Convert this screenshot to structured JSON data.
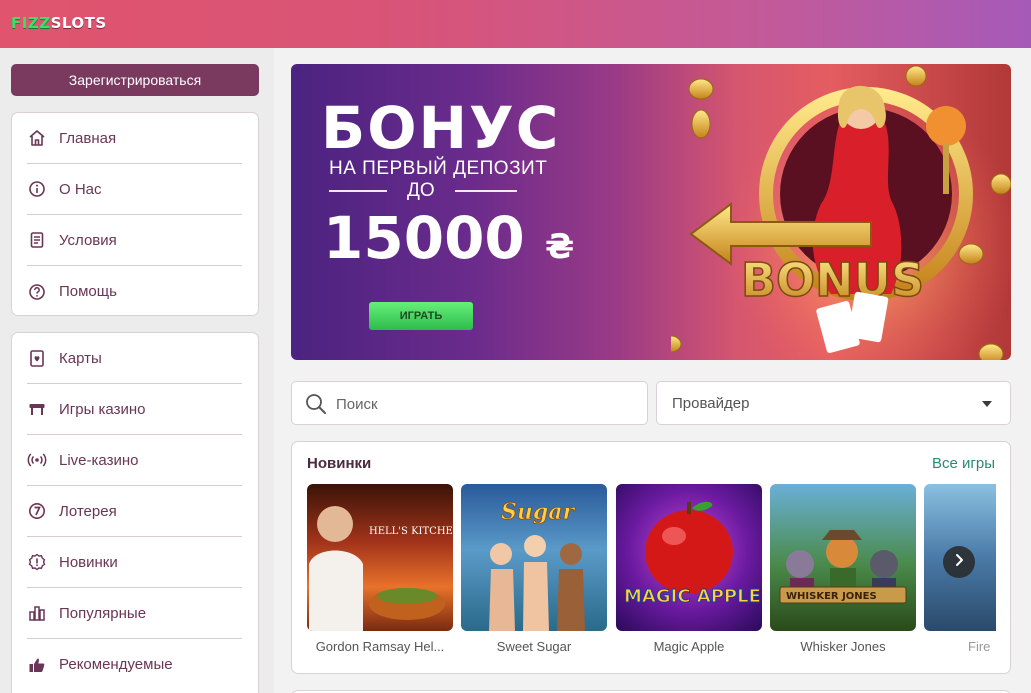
{
  "header": {
    "logo_part1": "FIZZ",
    "logo_part2": "SLOTS"
  },
  "sidebar": {
    "register_label": "Зарегистрироваться",
    "menu_top": [
      {
        "label": "Главная",
        "icon": "home-icon"
      },
      {
        "label": "О Нас",
        "icon": "info-icon"
      },
      {
        "label": "Условия",
        "icon": "document-icon"
      },
      {
        "label": "Помощь",
        "icon": "help-icon"
      }
    ],
    "menu_games": [
      {
        "label": "Карты",
        "icon": "cards-icon"
      },
      {
        "label": "Игры казино",
        "icon": "table-icon"
      },
      {
        "label": "Live-казино",
        "icon": "broadcast-icon"
      },
      {
        "label": "Лотерея",
        "icon": "lottery-icon"
      },
      {
        "label": "Новинки",
        "icon": "new-badge-icon"
      },
      {
        "label": "Популярные",
        "icon": "bar-chart-icon"
      },
      {
        "label": "Рекомендуемые",
        "icon": "thumbs-up-icon"
      }
    ]
  },
  "banner": {
    "title": "БОНУС",
    "subtitle": "НА ПЕРВЫЙ ДЕПОЗИТ",
    "upto": "ДО",
    "amount": "15000",
    "currency": "₴",
    "play_label": "ИГРАТЬ",
    "art_text": "BONUS"
  },
  "filters": {
    "search_placeholder": "Поиск",
    "provider_label": "Провайдер"
  },
  "new_games": {
    "title": "Новинки",
    "all_link": "Все игры",
    "games": [
      {
        "name": "Gordon Ramsay Hel...",
        "thumb_text": "HELL'S KITCHEN"
      },
      {
        "name": "Sweet Sugar",
        "thumb_text": "Sugar"
      },
      {
        "name": "Magic Apple",
        "thumb_text": "MAGIC APPLE"
      },
      {
        "name": "Whisker Jones",
        "thumb_text": "WHISKER JONES"
      },
      {
        "name": "Fire",
        "thumb_text": ""
      }
    ]
  },
  "colors": {
    "accent": "#7a3a60",
    "link": "#2a8a72",
    "play_button": "#3ccf5a"
  }
}
